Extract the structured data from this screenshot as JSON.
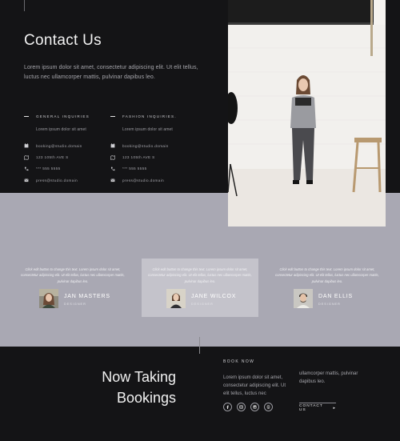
{
  "contact": {
    "title": "Contact Us",
    "intro": "Lorem ipsum dolor sit amet, consectetur adipiscing elit. Ut elit tellus, luctus nec ullamcorper mattis, pulvinar dapibus leo.",
    "columns": [
      {
        "heading": "GENERAL INQUIRIES",
        "sub": "Lorem ipsum dolor sit amet",
        "rows": [
          {
            "icon": "calendar-icon",
            "text": "booking@studio.domain"
          },
          {
            "icon": "map-icon",
            "text": "123 105th AVE S"
          },
          {
            "icon": "phone-icon",
            "text": "*** 555 5555"
          },
          {
            "icon": "mail-icon",
            "text": "press@studio.domain"
          }
        ]
      },
      {
        "heading": "FASHION INQUIRIES.",
        "sub": "Lorem ipsum dolor sit amet",
        "rows": [
          {
            "icon": "calendar-icon",
            "text": "booking@studio.domain"
          },
          {
            "icon": "map-icon",
            "text": "123 105th AVE S"
          },
          {
            "icon": "phone-icon",
            "text": "*** 555 5555"
          },
          {
            "icon": "mail-icon",
            "text": "press@studio.domain"
          }
        ]
      }
    ]
  },
  "testimonials": [
    {
      "quote": "Click edit button to change this text. Lorem ipsum dolor sit amet, consectetur adipiscing elit. Ut elit tellus, luctus nec ullamcorper mattis, pulvinar dapibus leo.",
      "name": "JAN MASTERS",
      "role": "DESIGNER"
    },
    {
      "quote": "Click edit button to change this text. Lorem ipsum dolor sit amet, consectetur adipiscing elit. Ut elit tellus, luctus nec ullamcorper mattis, pulvinar dapibus leo.",
      "name": "JANE WILCOX",
      "role": "DESIGNER"
    },
    {
      "quote": "Click edit button to change this text. Lorem ipsum dolor sit amet, consectetur adipiscing elit. Ut elit tellus, luctus nec ullamcorper mattis, pulvinar dapibus leo.",
      "name": "DAN ELLIS",
      "role": "DESIGNER"
    }
  ],
  "booking": {
    "title_line1": "Now Taking",
    "title_line2": "Bookings",
    "label": "BOOK NOW",
    "text1": "Lorem ipsum dolor sit amet, consectetur adipiscing elit. Ut elit tellus, luctus nec",
    "text2": "ullamcorper mattis, pulvinar dapibus leo.",
    "socials": [
      "facebook-icon",
      "instagram-icon",
      "linkedin-icon",
      "pinterest-icon"
    ],
    "button_label": "CONTACT US",
    "button_arrow": "▸"
  },
  "colors": {
    "dark": "#141416",
    "testimonial_bg": "#a9a8b3",
    "card_highlight": "#c4c3cb"
  }
}
